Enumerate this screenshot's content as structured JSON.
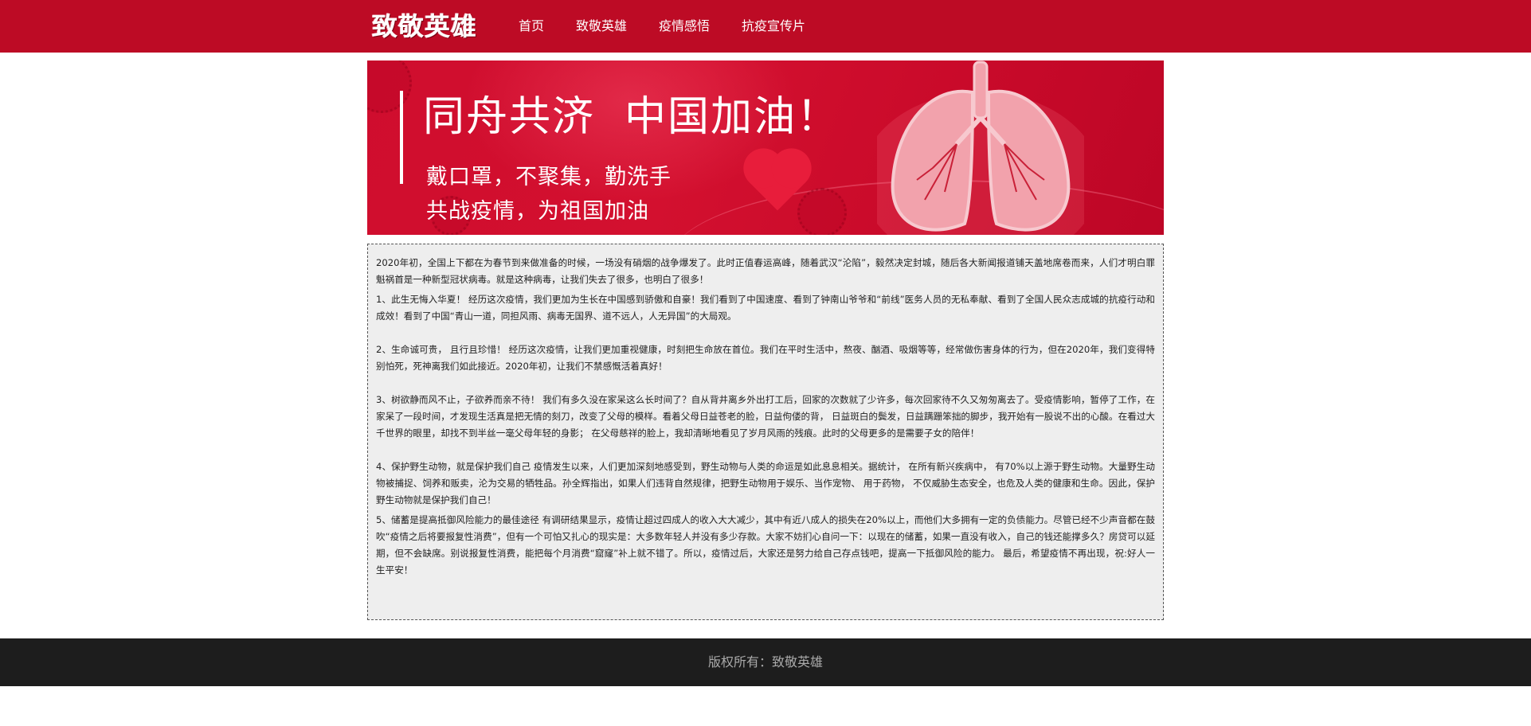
{
  "header": {
    "logo_text": "致敬英雄",
    "nav": [
      {
        "label": "首页"
      },
      {
        "label": "致敬英雄"
      },
      {
        "label": "疫情感悟"
      },
      {
        "label": "抗疫宣传片"
      }
    ]
  },
  "banner": {
    "title": "同舟共济  中国加油！",
    "line1": "戴口罩，不聚集，勤洗手",
    "line2": "共战疫情，为祖国加油"
  },
  "article": {
    "paragraphs": [
      "2020年初，全国上下都在为春节到来做准备的时候，一场没有硝烟的战争爆发了。此时正值春运高峰，随着武汉“沦陷”，毅然决定封城，随后各大新闻报道铺天盖地席卷而来，人们才明白罪魁祸首是一种新型冠状病毒。就是这种病毒，让我们失去了很多，也明白了很多！",
      "1、此生无悔入华夏！ 经历这次疫情，我们更加为生长在中国感到骄傲和自豪！我们看到了中国速度、看到了钟南山爷爷和“前线”医务人员的无私奉献、看到了全国人民众志成城的抗疫行动和成效！看到了中国“青山一道，同担风雨、病毒无国界、道不远人，人无异国”的大局观。",
      "2、生命诚可贵， 且行且珍惜！ 经历这次疫情，让我们更加重视健康，时刻把生命放在首位。我们在平时生活中，熬夜、酗酒、吸烟等等，经常做伤害身体的行为，但在2020年，我们变得特别怕死，死神离我们如此接近。2020年初，让我们不禁感慨活着真好！",
      "3、树欲静而风不止，子欲养而亲不待！ 我们有多久没在家呆这么长时间了？自从背井离乡外出打工后，回家的次数就了少许多，每次回家待不久又匆匆离去了。受疫情影响，暂停了工作，在家呆了一段时间，才发现生活真是把无情的刻刀，改变了父母的模样。看着父母日益苍老的脸，日益佝偻的背， 日益斑白的鬓发，日益蹒跚笨拙的脚步，我开始有一股说不出的心酸。在看过大千世界的眼里，却找不到半丝一毫父母年轻的身影； 在父母慈祥的脸上，我却清晰地看见了岁月风雨的残痕。此时的父母更多的是需要子女的陪伴！",
      "4、保护野生动物，就是保护我们自己 疫情发生以来，人们更加深刻地感受到，野生动物与人类的命运是如此息息相关。据统计， 在所有新兴疾病中， 有70%以上源于野生动物。大量野生动物被捕捉、饲养和贩卖，沦为交易的牺牲品。孙全辉指出，如果人们违背自然规律，把野生动物用于娱乐、当作宠物、 用于药物， 不仅威胁生态安全，也危及人类的健康和生命。因此，保护野生动物就是保护我们自己！",
      "5、储蓄是提高抵御风险能力的最佳途径 有调研结果显示，疫情让超过四成人的收入大大减少，其中有近八成人的损失在20%以上，而他们大多拥有一定的负债能力。尽管已经不少声音都在鼓吹“疫情之后将要报复性消费”，但有一个可怕又扎心的现实是：大多数年轻人并没有多少存款。大家不妨扪心自问一下：以现在的储蓄，如果一直没有收入，自己的钱还能撑多久？房贷可以延期，但不会缺席。别说报复性消费，能把每个月消费“窟窿”补上就不错了。所以，疫情过后，大家还是努力给自己存点钱吧，提高一下抵御风险的能力。 最后，希望疫情不再出现，祝:好人一生平安！"
    ]
  },
  "footer": {
    "text": "版权所有：致敬英雄"
  },
  "colors": {
    "header_bg": "#bd0b25",
    "banner_bg": "#cf0d2e",
    "content_bg": "#eeeeee",
    "footer_bg": "#1d1d1d"
  }
}
